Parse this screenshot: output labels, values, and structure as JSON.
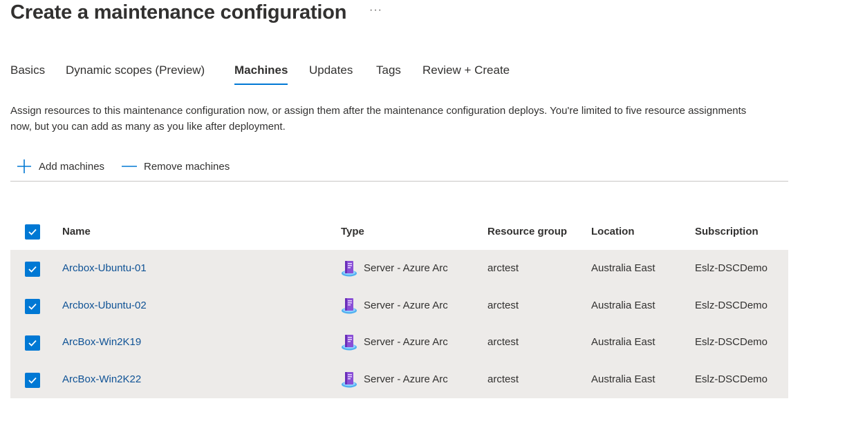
{
  "header": {
    "title": "Create a maintenance configuration",
    "more_label": "···"
  },
  "tabs": [
    {
      "label": "Basics",
      "active": false
    },
    {
      "label": "Dynamic scopes (Preview)",
      "active": false
    },
    {
      "label": "Machines",
      "active": true
    },
    {
      "label": "Updates",
      "active": false
    },
    {
      "label": "Tags",
      "active": false
    },
    {
      "label": "Review + Create",
      "active": false
    }
  ],
  "description": "Assign resources to this maintenance configuration now, or assign them after the maintenance configuration deploys. You're limited to five resource assignments now, but you can add as many as you like after deployment.",
  "toolbar": {
    "add_label": "Add machines",
    "remove_label": "Remove machines"
  },
  "table": {
    "columns": [
      "Name",
      "Type",
      "Resource group",
      "Location",
      "Subscription"
    ],
    "select_all_checked": true,
    "rows": [
      {
        "checked": true,
        "name": "Arcbox-Ubuntu-01",
        "type": "Server - Azure Arc",
        "resource_group": "arctest",
        "location": "Australia East",
        "subscription": "Eslz-DSCDemo",
        "icon": "azure-arc-server-icon"
      },
      {
        "checked": true,
        "name": "Arcbox-Ubuntu-02",
        "type": "Server - Azure Arc",
        "resource_group": "arctest",
        "location": "Australia East",
        "subscription": "Eslz-DSCDemo",
        "icon": "azure-arc-server-icon"
      },
      {
        "checked": true,
        "name": "ArcBox-Win2K19",
        "type": "Server - Azure Arc",
        "resource_group": "arctest",
        "location": "Australia East",
        "subscription": "Eslz-DSCDemo",
        "icon": "azure-arc-server-icon"
      },
      {
        "checked": true,
        "name": "ArcBox-Win2K22",
        "type": "Server - Azure Arc",
        "resource_group": "arctest",
        "location": "Australia East",
        "subscription": "Eslz-DSCDemo",
        "icon": "azure-arc-server-icon"
      }
    ]
  },
  "colors": {
    "accent": "#0078d4",
    "link": "#0f5295",
    "row_background": "#edebe9",
    "text": "#323130"
  }
}
